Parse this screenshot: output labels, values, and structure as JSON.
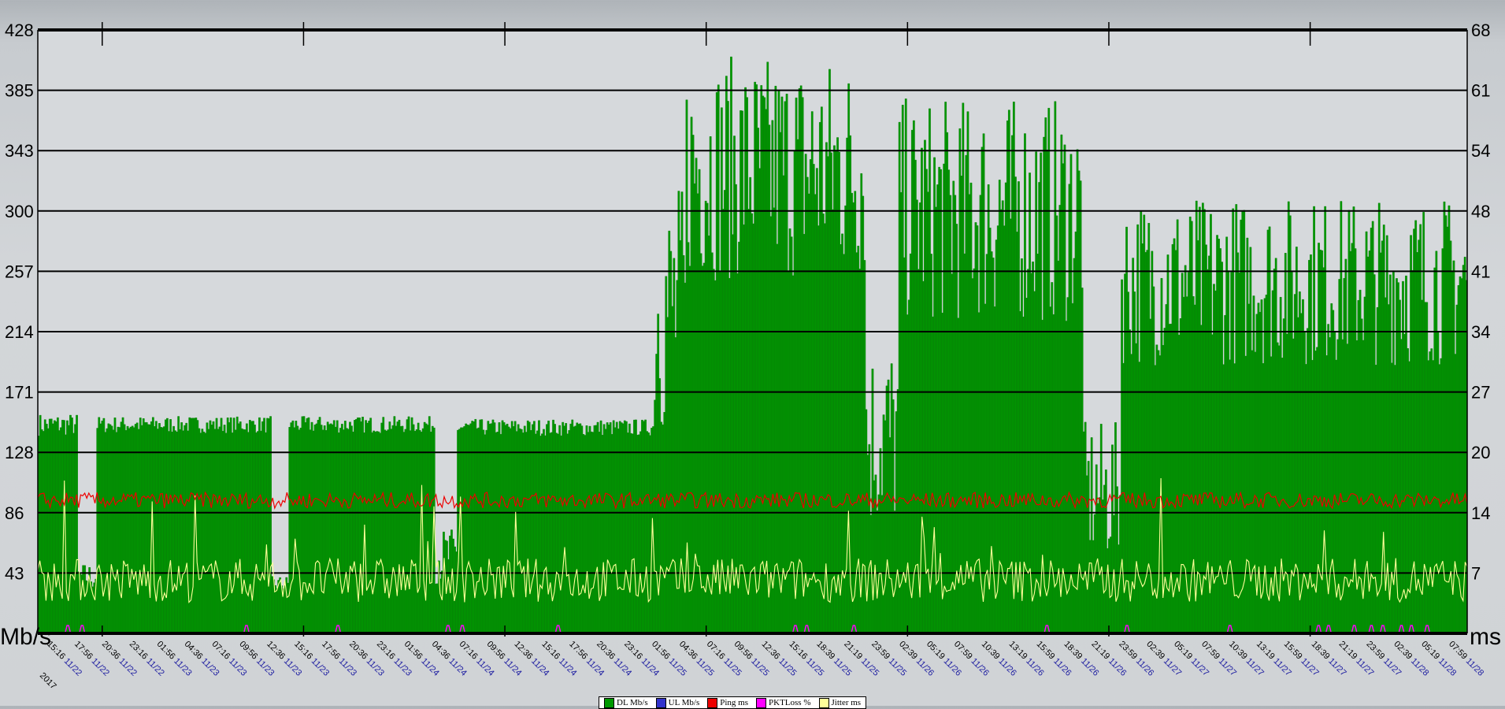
{
  "chart_data": {
    "type": "area",
    "title": "",
    "ylabel_left": "Mb/s",
    "ylabel_right": "ms",
    "year_label": "2017",
    "ylim_left": [
      0,
      428
    ],
    "ylim_right": [
      0,
      68
    ],
    "y_ticks_left": [
      "0",
      "43",
      "86",
      "128",
      "171",
      "214",
      "257",
      "300",
      "343",
      "385",
      "428"
    ],
    "y_ticks_right": [
      "0",
      "7",
      "14",
      "20",
      "27",
      "34",
      "41",
      "48",
      "54",
      "61",
      "68"
    ],
    "grid": true,
    "legend_position": "bottom-center",
    "x_labels": [
      {
        "time": "15:16",
        "date": "11/22"
      },
      {
        "time": "17:56",
        "date": "11/22"
      },
      {
        "time": "20:36",
        "date": "11/22"
      },
      {
        "time": "23:16",
        "date": "11/22"
      },
      {
        "time": "01:56",
        "date": "11/23"
      },
      {
        "time": "04:36",
        "date": "11/23"
      },
      {
        "time": "07:16",
        "date": "11/23"
      },
      {
        "time": "09:56",
        "date": "11/23"
      },
      {
        "time": "12:36",
        "date": "11/23"
      },
      {
        "time": "15:16",
        "date": "11/23"
      },
      {
        "time": "17:56",
        "date": "11/23"
      },
      {
        "time": "20:36",
        "date": "11/23"
      },
      {
        "time": "23:16",
        "date": "11/23"
      },
      {
        "time": "01:56",
        "date": "11/24"
      },
      {
        "time": "04:36",
        "date": "11/24"
      },
      {
        "time": "07:16",
        "date": "11/24"
      },
      {
        "time": "09:56",
        "date": "11/24"
      },
      {
        "time": "12:36",
        "date": "11/24"
      },
      {
        "time": "15:16",
        "date": "11/24"
      },
      {
        "time": "17:56",
        "date": "11/24"
      },
      {
        "time": "20:36",
        "date": "11/24"
      },
      {
        "time": "23:16",
        "date": "11/24"
      },
      {
        "time": "01:56",
        "date": "11/25"
      },
      {
        "time": "04:36",
        "date": "11/25"
      },
      {
        "time": "07:16",
        "date": "11/25"
      },
      {
        "time": "09:56",
        "date": "11/25"
      },
      {
        "time": "12:36",
        "date": "11/25"
      },
      {
        "time": "15:16",
        "date": "11/25"
      },
      {
        "time": "18:39",
        "date": "11/25"
      },
      {
        "time": "21:19",
        "date": "11/25"
      },
      {
        "time": "23:59",
        "date": "11/25"
      },
      {
        "time": "02:39",
        "date": "11/26"
      },
      {
        "time": "05:19",
        "date": "11/26"
      },
      {
        "time": "07:59",
        "date": "11/26"
      },
      {
        "time": "10:39",
        "date": "11/26"
      },
      {
        "time": "13:19",
        "date": "11/26"
      },
      {
        "time": "15:59",
        "date": "11/26"
      },
      {
        "time": "18:39",
        "date": "11/26"
      },
      {
        "time": "21:19",
        "date": "11/26"
      },
      {
        "time": "23:59",
        "date": "11/26"
      },
      {
        "time": "02:39",
        "date": "11/27"
      },
      {
        "time": "05:19",
        "date": "11/27"
      },
      {
        "time": "07:59",
        "date": "11/27"
      },
      {
        "time": "10:39",
        "date": "11/27"
      },
      {
        "time": "13:19",
        "date": "11/27"
      },
      {
        "time": "15:59",
        "date": "11/27"
      },
      {
        "time": "18:39",
        "date": "11/27"
      },
      {
        "time": "21:19",
        "date": "11/27"
      },
      {
        "time": "23:59",
        "date": "11/27"
      },
      {
        "time": "02:39",
        "date": "11/28"
      },
      {
        "time": "05:19",
        "date": "11/28"
      },
      {
        "time": "07:59",
        "date": "11/28"
      }
    ],
    "dl_segments": [
      {
        "from": 0.0,
        "to": 1.4,
        "base": 148,
        "jitter": 8
      },
      {
        "from": 1.4,
        "to": 2.1,
        "base": 40,
        "jitter": 10
      },
      {
        "from": 2.1,
        "to": 8.4,
        "base": 148,
        "jitter": 6
      },
      {
        "from": 8.4,
        "to": 9.0,
        "base": 35,
        "jitter": 6
      },
      {
        "from": 9.0,
        "to": 14.3,
        "base": 148,
        "jitter": 6
      },
      {
        "from": 14.3,
        "to": 15.1,
        "base": 55,
        "jitter": 20
      },
      {
        "from": 15.1,
        "to": 22.2,
        "base": 146,
        "jitter": 6
      },
      {
        "from": 22.2,
        "to": 23.3,
        "base": 230,
        "jitter": 90
      },
      {
        "from": 23.3,
        "to": 29.8,
        "base": 330,
        "jitter": 80
      },
      {
        "from": 29.8,
        "to": 31.0,
        "base": 140,
        "jitter": 70
      },
      {
        "from": 31.0,
        "to": 37.6,
        "base": 300,
        "jitter": 80
      },
      {
        "from": 37.6,
        "to": 39.0,
        "base": 100,
        "jitter": 50
      },
      {
        "from": 39.0,
        "to": 42.5,
        "base": 250,
        "jitter": 60
      }
    ],
    "series": [
      {
        "name": "DL Mb/s",
        "color": "#009900",
        "axis": "left",
        "type": "area",
        "range_mbps": [
          25,
          428
        ]
      },
      {
        "name": "UL Mb/s",
        "color": "#3333cc",
        "axis": "left",
        "type": "line"
      },
      {
        "name": "Ping ms",
        "color": "#ee0000",
        "axis": "right",
        "type": "line",
        "typical_ms": 15,
        "range_ms": [
          12,
          38
        ]
      },
      {
        "name": "PKTLoss %",
        "color": "#ff00ff",
        "axis": "left",
        "type": "marker",
        "x_marks_fraction": [
          0.021,
          0.031,
          0.146,
          0.21,
          0.287,
          0.297,
          0.364,
          0.53,
          0.538,
          0.571,
          0.706,
          0.762,
          0.834,
          0.896,
          0.903,
          0.921,
          0.933,
          0.941,
          0.954,
          0.961,
          0.972
        ]
      },
      {
        "name": "Jitter ms",
        "color": "#ffff99",
        "axis": "right",
        "type": "line",
        "typical_ms": 6,
        "range_ms": [
          0,
          48
        ]
      }
    ]
  }
}
